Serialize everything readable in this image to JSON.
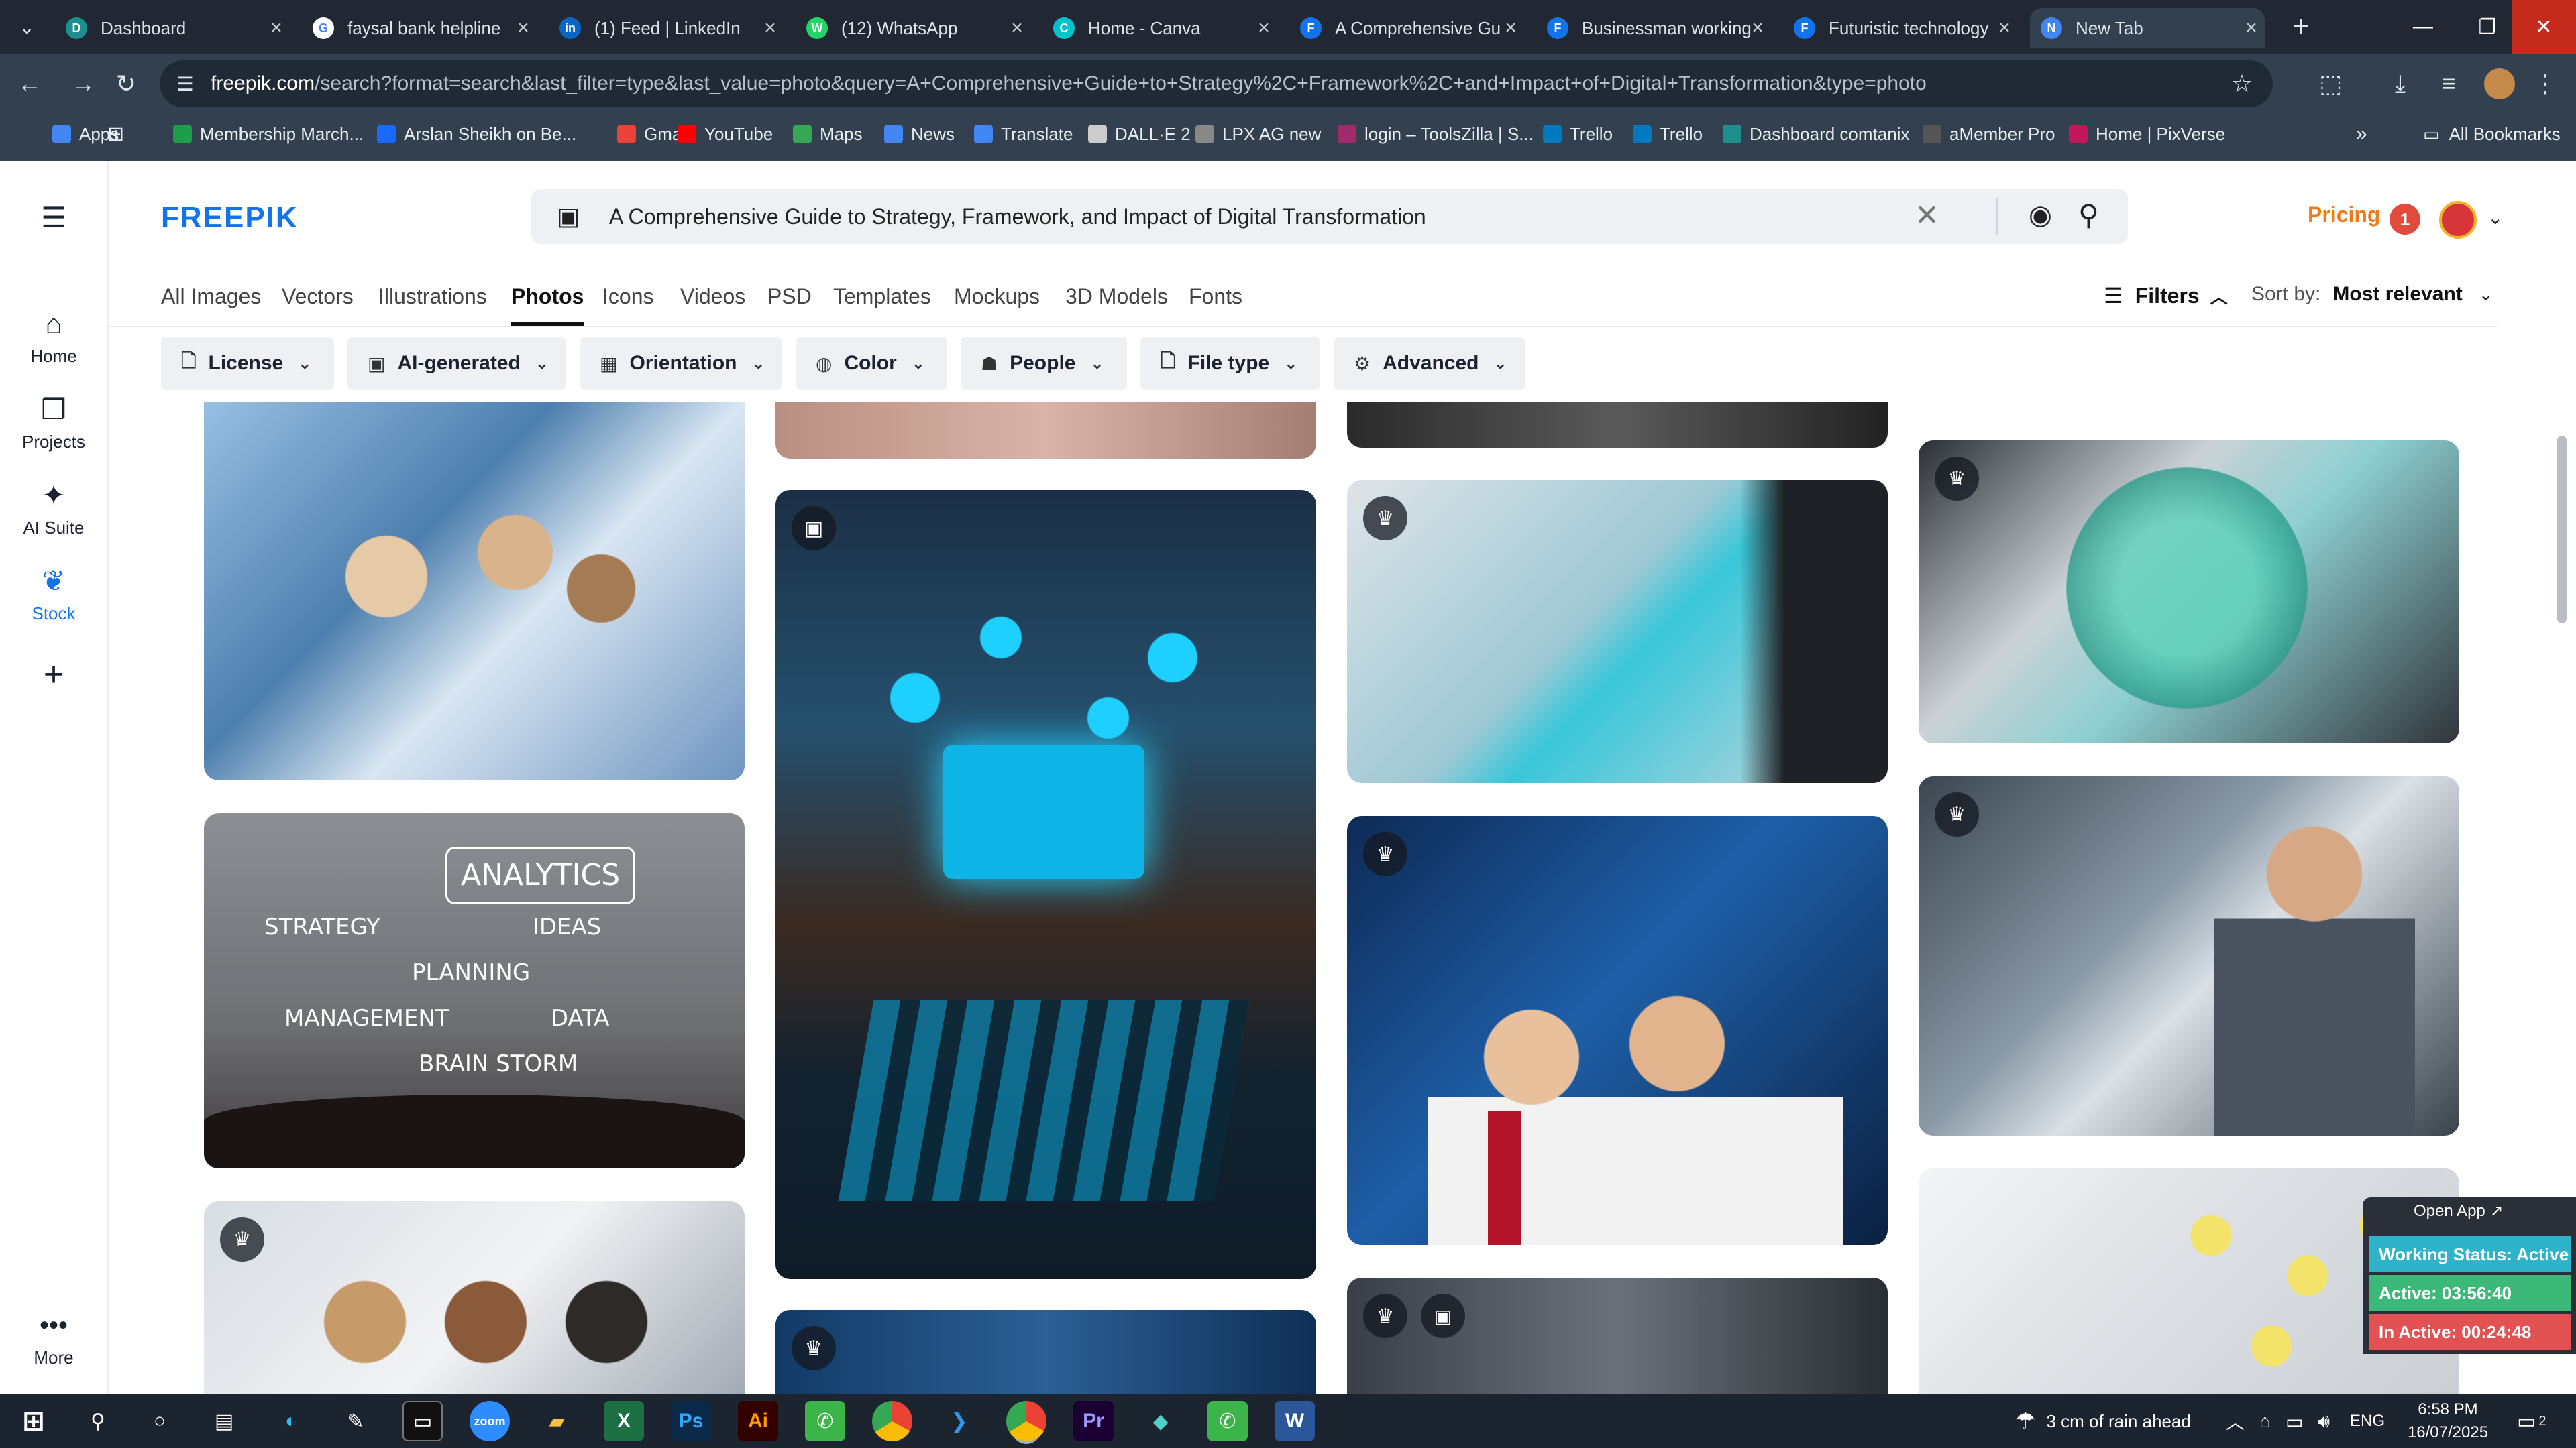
{
  "browser": {
    "tabs": [
      {
        "title": "Dashboard",
        "color": "#1e8f8f",
        "letter": "D"
      },
      {
        "title": "faysal bank helpline",
        "color": "#ffffff",
        "letter": "G"
      },
      {
        "title": "(1) Feed | LinkedIn",
        "color": "#0a66c2",
        "letter": "in"
      },
      {
        "title": "(12) WhatsApp",
        "color": "#25d366",
        "letter": "W"
      },
      {
        "title": "Home - Canva",
        "color": "#00c4cc",
        "letter": "C"
      },
      {
        "title": "A Comprehensive Gu",
        "color": "#1273eb",
        "letter": "F"
      },
      {
        "title": "Businessman working",
        "color": "#1273eb",
        "letter": "F"
      },
      {
        "title": "Futuristic technology",
        "color": "#1273eb",
        "letter": "F"
      },
      {
        "title": "New Tab",
        "color": "#4285f4",
        "letter": "N"
      }
    ],
    "url_host": "freepik.com",
    "url_path": "/search?format=search&last_filter=type&last_value=photo&query=A+Comprehensive+Guide+to+Strategy%2C+Framework%2C+and+Impact+of+Digital+Transformation&type=photo",
    "bookmarks": [
      {
        "label": "Apps",
        "color": "#4285f4"
      },
      {
        "label": "Membership March...",
        "color": "#1e9e4a"
      },
      {
        "label": "Arslan Sheikh on Be...",
        "color": "#1769ff"
      },
      {
        "label": "Gmail",
        "color": "#ea4335"
      },
      {
        "label": "YouTube",
        "color": "#ff0000"
      },
      {
        "label": "Maps",
        "color": "#34a853"
      },
      {
        "label": "News",
        "color": "#4285f4"
      },
      {
        "label": "Translate",
        "color": "#4285f4"
      },
      {
        "label": "DALL·E 2",
        "color": "#cccccc"
      },
      {
        "label": "LPX AG new",
        "color": "#888888"
      },
      {
        "label": "login – ToolsZilla | S...",
        "color": "#a12a6a"
      },
      {
        "label": "Trello",
        "color": "#0079bf"
      },
      {
        "label": "Trello",
        "color": "#0079bf"
      },
      {
        "label": "Dashboard comtanix",
        "color": "#1e8f8f"
      },
      {
        "label": "aMember Pro",
        "color": "#555555"
      },
      {
        "label": "Home | PixVerse",
        "color": "#c2185b"
      }
    ],
    "all_bookmarks": "All Bookmarks"
  },
  "freepik": {
    "logo": "FREEPIK",
    "search_text": "A Comprehensive Guide to Strategy, Framework, and Impact of Digital Transformation",
    "pricing": "Pricing",
    "notif_count": "1",
    "nav": [
      {
        "label": "Home",
        "icon": "⌂"
      },
      {
        "label": "Projects",
        "icon": "❐"
      },
      {
        "label": "AI Suite",
        "icon": "✦"
      },
      {
        "label": "Stock",
        "icon": "❦"
      }
    ],
    "nav_add": "+",
    "nav_more": "More",
    "categories": [
      "All Images",
      "Vectors",
      "Illustrations",
      "Photos",
      "Icons",
      "Videos",
      "PSD",
      "Templates",
      "Mockups",
      "3D Models",
      "Fonts"
    ],
    "active_category": "Photos",
    "filters_label": "Filters",
    "sort_label": "Sort by:",
    "sort_value": "Most relevant",
    "filter_buttons": [
      {
        "label": "License",
        "icon": "🗋"
      },
      {
        "label": "AI-generated",
        "icon": "▣"
      },
      {
        "label": "Orientation",
        "icon": "▦"
      },
      {
        "label": "Color",
        "icon": "◍"
      },
      {
        "label": "People",
        "icon": "☗"
      },
      {
        "label": "File type",
        "icon": "🗋"
      },
      {
        "label": "Advanced",
        "icon": "⚙"
      }
    ]
  },
  "widget": {
    "open_app": "Open App ↗",
    "status": "Working Status: Active",
    "active": "Active: 03:56:40",
    "inactive": "In Active: 00:24:48",
    "status_color": "#2fb3c8",
    "active_color": "#3cb878",
    "inactive_color": "#e35252"
  },
  "taskbar": {
    "weather": "3 cm of rain ahead",
    "lang": "ENG",
    "time": "6:58 PM",
    "date": "16/07/2025",
    "notif": "2"
  }
}
